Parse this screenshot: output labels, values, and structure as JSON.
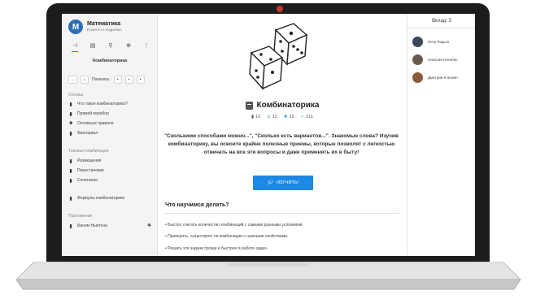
{
  "sidebar": {
    "brand_title": "Математика",
    "brand_subtitle": "Понятно и подробно",
    "logo_letter": "M",
    "heading": "Комбинаторика",
    "show_label": "Показать:",
    "sections": [
      {
        "label": "Основы",
        "items": [
          {
            "label": "Что такое комбинаторика?",
            "icon": "bookmark-icon"
          },
          {
            "label": "Прямой перебор",
            "icon": "bookmark-icon"
          },
          {
            "label": "Основные правила",
            "icon": "folder-icon"
          },
          {
            "label": "Факториал",
            "icon": "bookmark-icon"
          }
        ]
      },
      {
        "label": "Типовые комбинации",
        "items": [
          {
            "label": "Размещения",
            "icon": "bookmark-icon"
          },
          {
            "label": "Перестановки",
            "icon": "bookmark-icon"
          },
          {
            "label": "Сочетания",
            "icon": "bookmark-icon"
          }
        ]
      },
      {
        "label": "",
        "items": [
          {
            "label": "Формулы комбинаторики",
            "icon": "bookmark-icon"
          }
        ]
      },
      {
        "label": "Приложения",
        "items": [
          {
            "label": "Бином Ньютона",
            "icon": "bookmark-icon"
          }
        ]
      }
    ]
  },
  "main": {
    "title": "Комбинаторика",
    "stats": {
      "pages": "10",
      "checks": "12",
      "tasks": "12",
      "done": "211"
    },
    "description": "\"Сколькими способами можно...\", \"Сколько есть вариантов...\". Знакомые слова? Изучив комбинаторику, вы освоите крайне полезные приемы, которые позволят с легкостью отвечать на все эти вопросы и даже применять их в быту!",
    "study_button": "ИЗУЧИТЬ!",
    "learn_heading": "Что научимся делать?",
    "bullets": [
      "• Быстро считать количество комбинаций с самыми разными условиями.",
      "• Проверять, существуют ли комбинации с нужными свойствами.",
      "• Решать эти задачи проще и быстрее в работе задач."
    ]
  },
  "right_panel": {
    "heading": "Вклад: 3",
    "contributors": [
      {
        "name": "Петр Радько",
        "color": "#3b4a5a"
      },
      {
        "name": "Николай Нагибин",
        "color": "#6a5a4e"
      },
      {
        "name": "Дмитрий Клепкин",
        "color": "#8a5a3a"
      }
    ]
  },
  "colors": {
    "accent": "#1e88e5",
    "laptop_body": "#1c1c1e",
    "camera": "#c0392b"
  }
}
